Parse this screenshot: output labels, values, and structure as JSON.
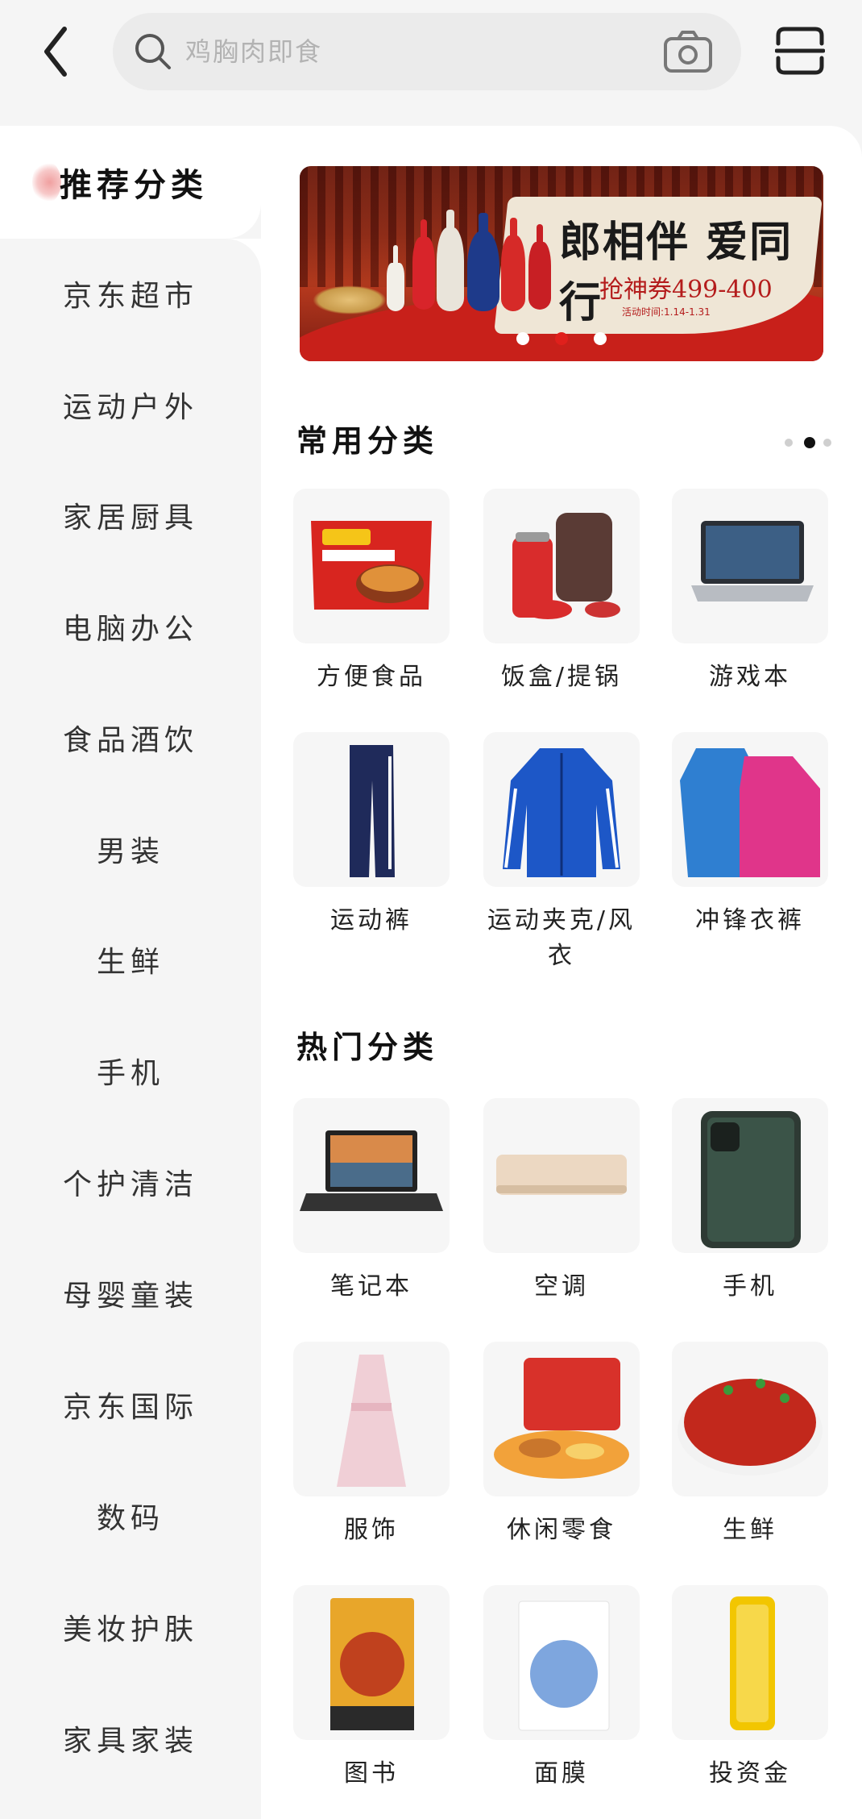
{
  "search": {
    "placeholder": "鸡胸肉即食"
  },
  "sidebar": {
    "items": [
      {
        "label": "推荐分类"
      },
      {
        "label": "京东超市"
      },
      {
        "label": "运动户外"
      },
      {
        "label": "家居厨具"
      },
      {
        "label": "电脑办公"
      },
      {
        "label": "食品酒饮"
      },
      {
        "label": "男装"
      },
      {
        "label": "生鲜"
      },
      {
        "label": "手机"
      },
      {
        "label": "个护清洁"
      },
      {
        "label": "母婴童装"
      },
      {
        "label": "京东国际"
      },
      {
        "label": "数码"
      },
      {
        "label": "美妆护肤"
      },
      {
        "label": "家具家装"
      }
    ]
  },
  "banner": {
    "title": "郎相伴 爱同行",
    "subtitle": "抢神券499-400",
    "date": "活动时间:1.14-1.31",
    "slides_total": 3,
    "active_slide": 2
  },
  "common": {
    "title": "常用分类",
    "pages_total": 3,
    "active_page": 2,
    "items": [
      {
        "label": "方便食品",
        "icon": "instant-noodles"
      },
      {
        "label": "饭盒/提锅",
        "icon": "lunch-box"
      },
      {
        "label": "游戏本",
        "icon": "gaming-laptop"
      },
      {
        "label": "运动裤",
        "icon": "sport-pants"
      },
      {
        "label": "运动夹克/风衣",
        "icon": "sport-jacket"
      },
      {
        "label": "冲锋衣裤",
        "icon": "outdoor-jacket"
      }
    ]
  },
  "hot": {
    "title": "热门分类",
    "items": [
      {
        "label": "笔记本",
        "icon": "laptop"
      },
      {
        "label": "空调",
        "icon": "air-conditioner"
      },
      {
        "label": "手机",
        "icon": "smartphone"
      },
      {
        "label": "服饰",
        "icon": "dress"
      },
      {
        "label": "休闲零食",
        "icon": "snacks"
      },
      {
        "label": "生鲜",
        "icon": "crayfish"
      },
      {
        "label": "图书",
        "icon": "book"
      },
      {
        "label": "面膜",
        "icon": "face-mask"
      },
      {
        "label": "投资金",
        "icon": "gold-bar"
      }
    ]
  },
  "colors": {
    "accent": "#e0201c",
    "sidebar_bg": "#f5f5f5",
    "content_bg": "#ffffff"
  }
}
